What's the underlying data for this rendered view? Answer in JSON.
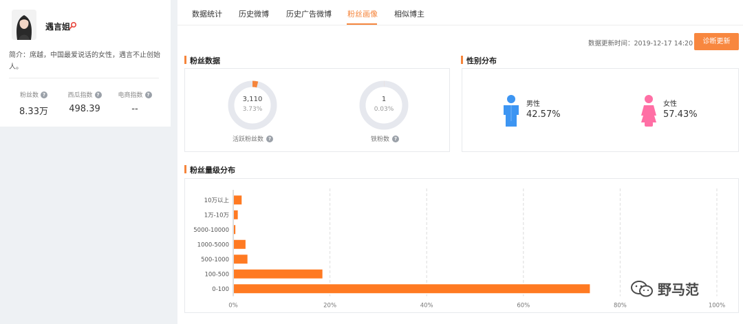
{
  "profile": {
    "name": "遇言姐",
    "bio": "简介：席越，中国最爱说话的女性，遇言不止创始人。",
    "stats": [
      {
        "label": "粉丝数",
        "value": "8.33万"
      },
      {
        "label": "西瓜指数",
        "value": "498.39"
      },
      {
        "label": "电商指数",
        "value": "--"
      }
    ]
  },
  "tabs": [
    {
      "label": "数据统计",
      "active": false
    },
    {
      "label": "历史微博",
      "active": false
    },
    {
      "label": "历史广告微博",
      "active": false
    },
    {
      "label": "粉丝画像",
      "active": true
    },
    {
      "label": "相似博主",
      "active": false
    }
  ],
  "toolbar": {
    "update_time": "数据更新时间：2019-12-17 14:20",
    "update_button": "诊断更新"
  },
  "fans_data": {
    "title": "粉丝数据",
    "active": {
      "number": "3,110",
      "percent": "3.73%",
      "label": "活跃粉丝数",
      "fraction": 0.0373
    },
    "iron": {
      "number": "1",
      "percent": "0.03%",
      "label": "铁粉数",
      "fraction": 0.0003
    }
  },
  "gender": {
    "title": "性别分布",
    "male": {
      "label": "男性",
      "percent": "42.57%"
    },
    "female": {
      "label": "女性",
      "percent": "57.43%"
    }
  },
  "distribution": {
    "title": "粉丝量级分布"
  },
  "chart_data": {
    "type": "bar",
    "orientation": "horizontal",
    "categories": [
      "10万以上",
      "1万-10万",
      "5000-10000",
      "1000-5000",
      "500-1000",
      "100-500",
      "0-100"
    ],
    "values": [
      1.6,
      0.8,
      0.3,
      2.4,
      2.8,
      18.3,
      73.6
    ],
    "x_ticks": [
      "0%",
      "20%",
      "40%",
      "60%",
      "80%",
      "100%"
    ],
    "xlim": [
      0,
      100
    ],
    "grid": true,
    "color": "#ff7a22"
  },
  "colors": {
    "accent": "#f5853c",
    "male": "#3d95f2",
    "female": "#ff6fa5",
    "donut_track": "#e6e8ee"
  },
  "watermark": "野马范"
}
